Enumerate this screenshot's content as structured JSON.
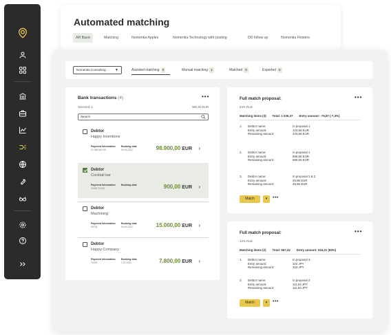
{
  "colors": {
    "sidebar": "#2b2b2b",
    "accent_green": "#6a8a38",
    "match_yellow": "#e8c74e",
    "selected_row": "#e8ece5"
  },
  "sidebar": {
    "icons": [
      "logo-icon",
      "user-icon",
      "grid-icon",
      "bank-icon",
      "briefcase-icon",
      "chart-icon",
      "matching-icon",
      "globe-icon",
      "wrench-icon",
      "glasses-icon",
      "settings-icon",
      "help-icon",
      "expand-icon"
    ]
  },
  "back_panel": {
    "title": "Automated matching",
    "tabs": [
      "AR Basic",
      "Matching",
      "Nomentia Apples",
      "Nomentia Technology with posting",
      "DD follow up",
      "Nomentia Flowers"
    ]
  },
  "filter": {
    "company": "Nomentia Consulting",
    "tabs": [
      {
        "label": "Assisted matching",
        "count": "0"
      },
      {
        "label": "Manual matching",
        "count": "1"
      },
      {
        "label": "Matched",
        "count": "0"
      },
      {
        "label": "Exported",
        "count": "0"
      }
    ]
  },
  "bank": {
    "title": "Bank transactions",
    "count": "(4)",
    "selected": "Selected: 1",
    "selected_amount": "960,50 EUR",
    "search_placeholder": "Search",
    "transactions": [
      {
        "type": "Debtor",
        "name": "Happy Inventions",
        "info_label": "Payment information",
        "info_value": "21 468 661 95",
        "date_label": "Booking date",
        "date_value": "03.06.2022",
        "amount": "98.900,00",
        "currency": "EUR",
        "selected": false
      },
      {
        "type": "Debtor",
        "name": "Cocktail bar",
        "info_label": "Payment information",
        "info_value": "12345 72345",
        "date_label": "Booking date",
        "date_value": "",
        "amount": "900,00",
        "currency": "EUR",
        "selected": true
      },
      {
        "type": "Debtor",
        "name": "Machining",
        "info_label": "Payment information",
        "info_value": "49733",
        "date_label": "Booking date",
        "date_value": "04.09.2022",
        "amount": "15.000,00",
        "currency": "EUR",
        "selected": false
      },
      {
        "type": "Debtor",
        "name": "Happy Company",
        "info_label": "Payment information",
        "info_value": "74295",
        "date_label": "Booking date",
        "date_value": "1.07.2022",
        "amount": "7.800,00",
        "currency": "EUR",
        "selected": false
      }
    ]
  },
  "proposals": [
    {
      "title": "Full match proposal:",
      "rule": "84% Rule",
      "head": {
        "items": "Matching items (3)",
        "total": "Total: 1 026,37",
        "entry": "Entry amount: -75,87 (-7,3%)"
      },
      "items": [
        {
          "num": "1.",
          "left": "Debtor name:\nEntry amount:\nRemaining amount:",
          "right": "In proposal 1\n123,55 EUR\n343,66 EUR"
        },
        {
          "num": "2.",
          "left": "Debtor name:\nEntry amount:\nRemaining amount:",
          "right": "In proposal 1\n865,55 EUR\n865,55 EUR"
        },
        {
          "num": "3.",
          "left": "Debtor name:\nEntry amount:\nRemaining amount:",
          "right": "In proposal 1 & 2\n45,86 EUR\n45,86 EUR"
        }
      ],
      "match_label": "Match"
    },
    {
      "title": "Full match proposal:",
      "rule": "42% Rule",
      "head": {
        "items": "Matching items (2)",
        "total": "Total: 567,32",
        "entry": "Entry amount: 316,21 (83%)"
      },
      "items": [
        {
          "num": "1.",
          "left": "Debtor name:\nEntry amount:\nRemaining amount:",
          "right": "In proposal 3\n324 JPY\n324 JPY"
        },
        {
          "num": "2.",
          "left": "Debtor name:\nEntry amount:\nRemaining amount:",
          "right": "In proposal 2\n111,54 JPY\n111,54 JPY"
        }
      ],
      "match_label": "Match"
    }
  ]
}
